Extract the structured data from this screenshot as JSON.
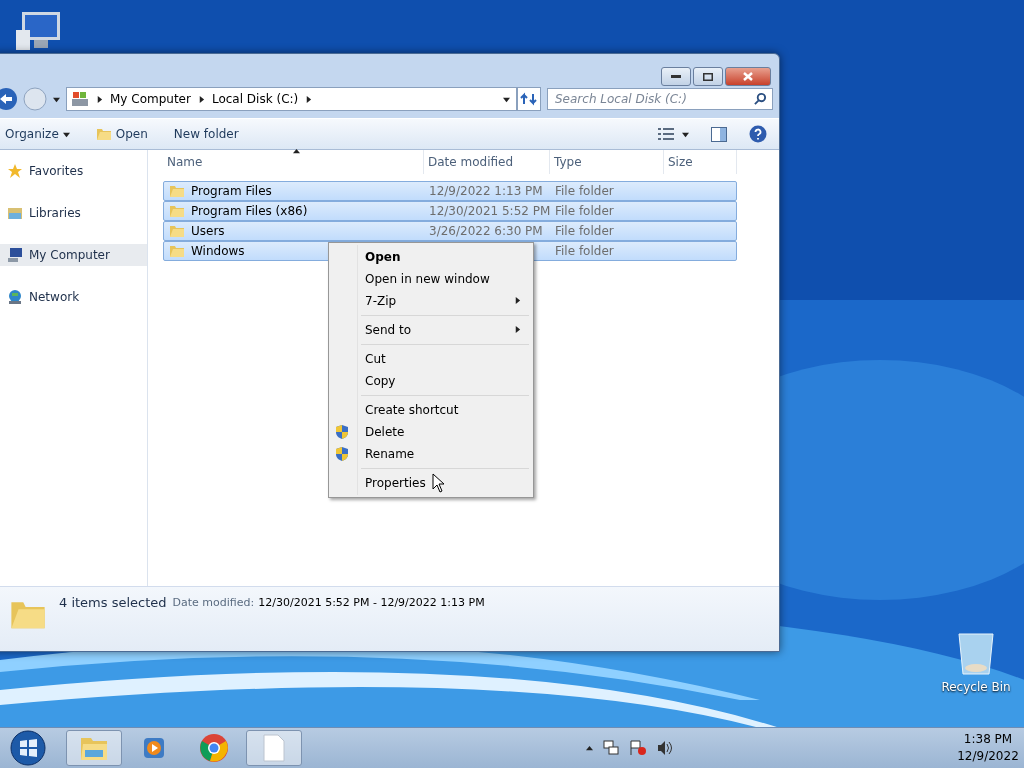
{
  "window": {
    "address": {
      "crumbs": [
        "My Computer",
        "Local Disk (C:)"
      ]
    },
    "search": {
      "placeholder": "Search Local Disk (C:)"
    },
    "toolbar": [
      {
        "label": "Organize",
        "kind": "menu"
      },
      {
        "label": "Open",
        "kind": "icon"
      },
      {
        "label": "New folder",
        "kind": "plain"
      }
    ],
    "sidebar": {
      "items": [
        {
          "label": "Favorites",
          "kind": "star",
          "selected": false
        },
        {
          "label": "Libraries",
          "kind": "library",
          "selected": false
        },
        {
          "label": "My Computer",
          "kind": "computer",
          "selected": true
        },
        {
          "label": "Network",
          "kind": "network",
          "selected": false
        }
      ]
    },
    "table": {
      "columns": [
        {
          "label": "Name",
          "sorted": true
        },
        {
          "label": "Date modified",
          "sorted": false
        },
        {
          "label": "Type",
          "sorted": false
        },
        {
          "label": "Size",
          "sorted": false
        }
      ],
      "rows": [
        {
          "name": "Program Files",
          "date": "12/9/2022 1:13 PM",
          "type": "File folder",
          "selected": true
        },
        {
          "name": "Program Files (x86)",
          "date": "12/30/2021 5:52 PM",
          "type": "File folder",
          "selected": true
        },
        {
          "name": "Users",
          "date": "3/26/2022 6:30 PM",
          "type": "File folder",
          "selected": true
        },
        {
          "name": "Windows",
          "date": "",
          "type": "File folder",
          "selected": true
        }
      ]
    },
    "status_bar": {
      "count": "4 items selected",
      "label": "Date modified:",
      "value": "12/30/2021 5:52 PM - 12/9/2022 1:13 PM"
    }
  },
  "context_menu": {
    "groups": [
      [
        {
          "label": "Open",
          "default": true,
          "submenu": false,
          "shield": false
        },
        {
          "label": "Open in new window",
          "default": false,
          "submenu": false,
          "shield": false
        },
        {
          "label": "7-Zip",
          "default": false,
          "submenu": true,
          "shield": false
        }
      ],
      [
        {
          "label": "Send to",
          "default": false,
          "submenu": true,
          "shield": false
        }
      ],
      [
        {
          "label": "Cut",
          "default": false,
          "submenu": false,
          "shield": false
        },
        {
          "label": "Copy",
          "default": false,
          "submenu": false,
          "shield": false
        }
      ],
      [
        {
          "label": "Create shortcut",
          "default": false,
          "submenu": false,
          "shield": false
        },
        {
          "label": "Delete",
          "default": false,
          "submenu": false,
          "shield": true
        },
        {
          "label": "Rename",
          "default": false,
          "submenu": false,
          "shield": true
        }
      ],
      [
        {
          "label": "Properties",
          "default": false,
          "submenu": false,
          "shield": false
        }
      ]
    ]
  },
  "desktop": {
    "icons": [
      {
        "label": "Recycle Bin"
      }
    ]
  },
  "taskbar": {
    "apps": [
      {
        "kind": "explorer",
        "open": true
      },
      {
        "kind": "media",
        "open": false
      },
      {
        "kind": "chrome",
        "open": false
      },
      {
        "kind": "document",
        "open": true
      }
    ],
    "time": "1:38 PM",
    "date": "12/9/2022"
  }
}
